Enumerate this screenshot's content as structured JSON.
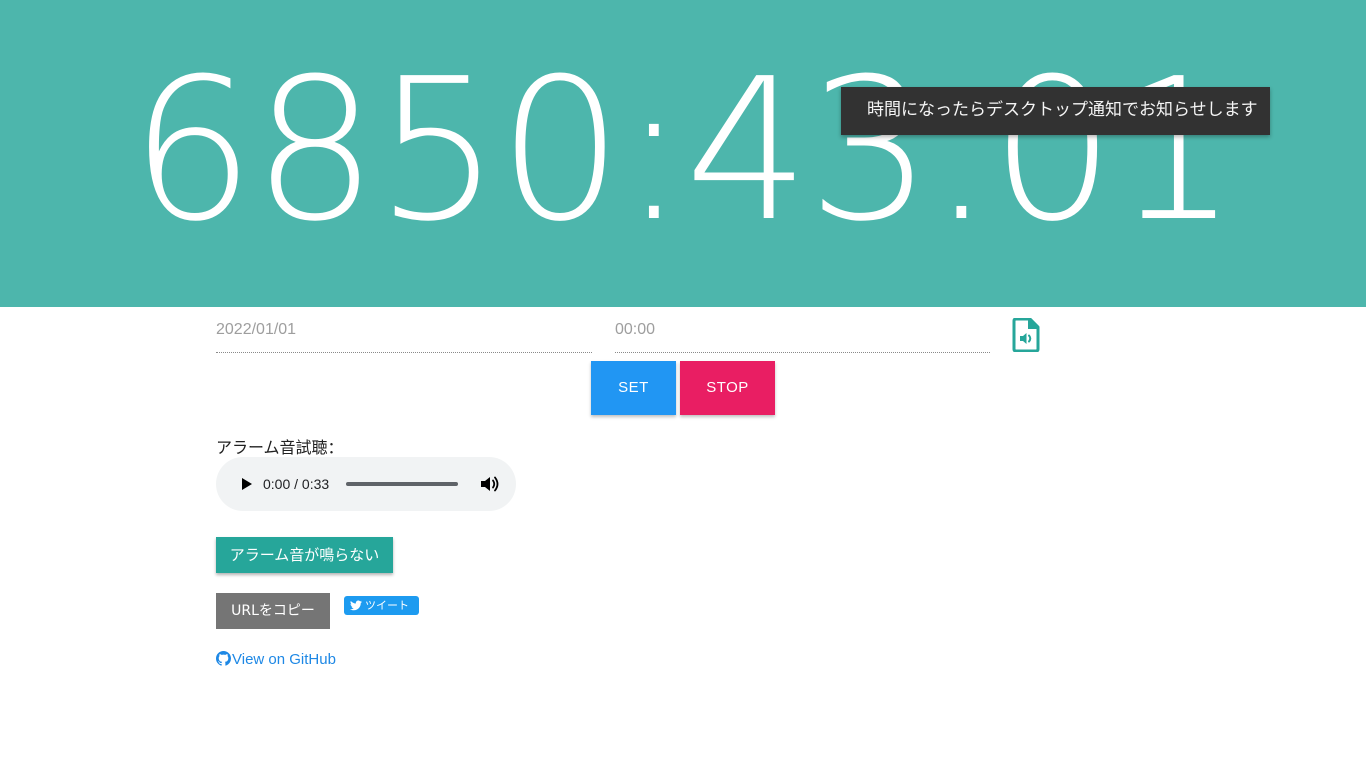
{
  "timer": {
    "display": "6850:43.01"
  },
  "toast": {
    "message": "時間になったらデスクトップ通知でお知らせします"
  },
  "form": {
    "date_value": "2022/01/01",
    "time_value": "00:00",
    "set_label": "SET",
    "stop_label": "STOP"
  },
  "preview": {
    "label": "アラーム音試聴：",
    "time_display": "0:00 / 0:33",
    "progress": 0
  },
  "actions": {
    "no_ring_label": "アラーム音が鳴らない",
    "copy_url_label": "URLをコピー",
    "tweet_label": "ツイート",
    "github_label": "View on GitHub"
  },
  "icons": {
    "audio_file": "file-audio-icon",
    "play": "play-icon",
    "volume": "volume-icon",
    "twitter": "twitter-bird-icon",
    "github": "github-icon"
  },
  "colors": {
    "hero_bg": "#4db6ac",
    "set": "#2196f3",
    "stop": "#e91e63",
    "no_ring": "#26a69a",
    "copy": "#757575",
    "tweet": "#1d9bf0",
    "link": "#1e88e5",
    "toast": "#323232"
  }
}
